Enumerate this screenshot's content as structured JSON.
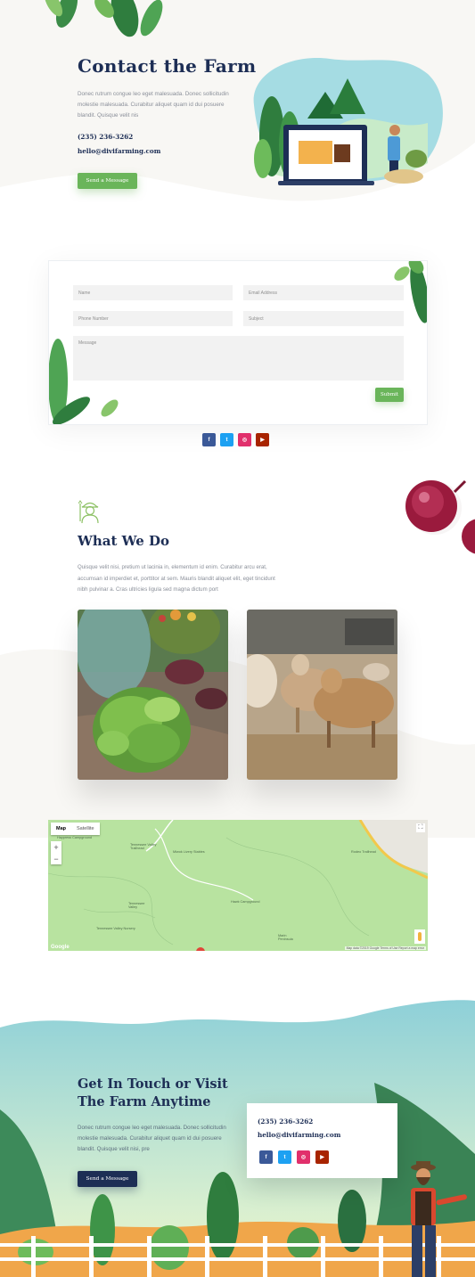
{
  "hero": {
    "title": "Contact the Farm",
    "body": "Donec rutrum congue leo eget malesuada. Donec sollicitudin molestie malesuada. Curabitur aliquet quam id dui posuere blandit. Quisque velit nis",
    "phone": "(235) 236-3262",
    "email": "hello@divifarming.com",
    "button": "Send a Message"
  },
  "form": {
    "name_placeholder": "Name",
    "email_placeholder": "Email Address",
    "phone_placeholder": "Phone Number",
    "subject_placeholder": "Subject",
    "message_placeholder": "Message",
    "submit": "Submit"
  },
  "social": {
    "facebook": "f",
    "twitter": "t",
    "instagram": "◎",
    "youtube": "▶"
  },
  "what_we_do": {
    "title": "What We Do",
    "body": "Quisque velit nisi, pretium ut lacinia in, elementum id enim. Curabitur arcu erat, accumsan id imperdiet et, porttitor at sem. Mauris blandit aliquet elit, eget tincidunt nibh pulvinar a. Cras ultricies ligula sed magna dictum port"
  },
  "map": {
    "tab_map": "Map",
    "tab_satellite": "Satellite",
    "zoom_in": "+",
    "zoom_out": "−",
    "labels": [
      "Haypress Campground",
      "Tennessee Valley Trailhead",
      "Miwok Livery Stables",
      "Rodeo Trailhead",
      "Hawk Campground",
      "Tennessee Valley",
      "Tennessee Valley Nursery",
      "Marin Peninsula"
    ],
    "google": "Google",
    "footer": "Map data ©2019 Google   Terms of Use   Report a map error"
  },
  "footer": {
    "title": "Get In Touch or Visit The Farm Anytime",
    "body": "Donec rutrum congue leo eget malesuada. Donec sollicitudin molestie malesuada. Curabitur aliquet quam id dui posuere blandit. Quisque velit nisi, pre",
    "button": "Send a Message",
    "phone": "(235) 236-3262",
    "email": "hello@divifarming.com"
  },
  "colors": {
    "navy": "#1d2e55",
    "green": "#6ab55a",
    "facebook": "#3b5998",
    "twitter": "#1da1f2",
    "instagram": "#e1306c",
    "youtube": "#a82400"
  }
}
